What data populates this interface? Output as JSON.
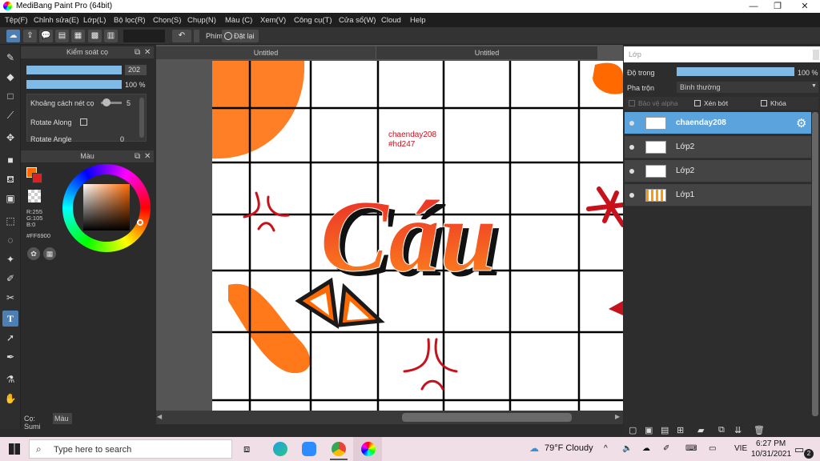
{
  "window": {
    "title": "MediBang Paint Pro (64bit)",
    "minimize": "—",
    "maximize": "❐",
    "close": "✕"
  },
  "menu": [
    "Tệp(F)",
    "Chỉnh sửa(E)",
    "Lớp(L)",
    "Bộ lọc(R)",
    "Chọn(S)",
    "Chụp(N)",
    "Màu (C)",
    "Xem(V)",
    "Công cụ(T)",
    "Cửa sổ(W)",
    "Cloud",
    "Help"
  ],
  "toolbar": {
    "phim_label": "Phím",
    "reset_label": "Đặt lại"
  },
  "brush_panel": {
    "title": "Kiểm soát cọ",
    "size_value": "202",
    "opacity_value": "100 %",
    "spacing_label": "Khoảng cách nét cọ",
    "spacing_value": "5",
    "rotate_along_label": "Rotate Along",
    "rotate_angle_label": "Rotate Angle",
    "rotate_angle_value": "0"
  },
  "color_panel": {
    "title": "Màu",
    "r": "R:255",
    "g": "G:105",
    "b": "B:0",
    "hex": "#FF6900",
    "fg_color": "#FF6900"
  },
  "left_tabs": {
    "tab1": "Cọ: Sumi",
    "tab2": "Màu"
  },
  "documents": {
    "tab1": "Untitled",
    "tab2": "Untitled"
  },
  "canvas": {
    "text1": "chaenday208",
    "text2": "#hd247",
    "big_word": "Cáu"
  },
  "layer_panel": {
    "title": "Lớp",
    "opacity_label": "Độ trong",
    "opacity_value": "100 %",
    "blend_label": "Pha trộn",
    "blend_value": "Bình thường",
    "protect_alpha": "Bảo vệ alpha",
    "clipping": "Xén bớt",
    "lock": "Khóa",
    "layers": [
      {
        "name": "chaenday208",
        "selected": true
      },
      {
        "name": "Lớp2",
        "selected": false
      },
      {
        "name": "Lớp2",
        "selected": false
      },
      {
        "name": "Lớp1",
        "selected": false
      }
    ]
  },
  "taskbar": {
    "search_placeholder": "Type here to search",
    "weather": "79°F  Cloudy",
    "language": "VIE",
    "time": "6:27 PM",
    "date": "10/31/2021",
    "notifications": "2"
  },
  "colors": {
    "accent": "#5ba3dc",
    "orange": "#FF6900",
    "red": "#c8121b"
  }
}
